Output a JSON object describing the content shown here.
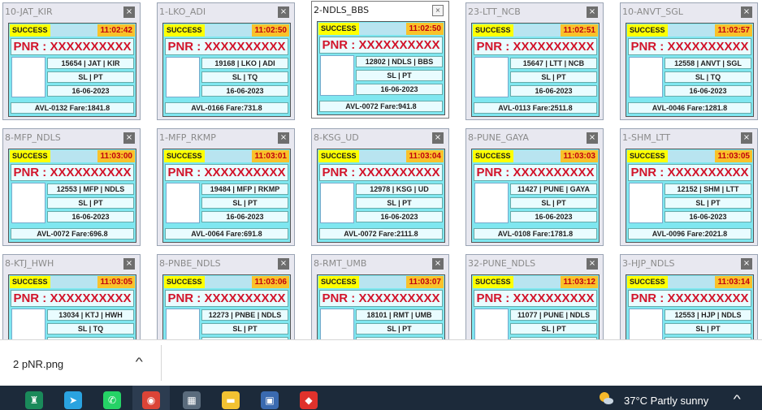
{
  "tiles": [
    {
      "title": "10-JAT_KIR",
      "status": "SUCCESS",
      "time": "11:02:42",
      "pnr": "PNR : XXXXXXXXXX",
      "train": "15654 | JAT | KIR",
      "cls": "SL | PT",
      "date": "16-06-2023",
      "avl": "AVL-0132 Fare:1841.8"
    },
    {
      "title": "1-LKO_ADI",
      "status": "SUCCESS",
      "time": "11:02:50",
      "pnr": "PNR : XXXXXXXXXX",
      "train": "19168 | LKO | ADI",
      "cls": "SL | TQ",
      "date": "16-06-2023",
      "avl": "AVL-0166 Fare:731.8"
    },
    {
      "title": "2-NDLS_BBS",
      "status": "SUCCESS",
      "time": "11:02:50",
      "pnr": "PNR : XXXXXXXXXX",
      "train": "12802 | NDLS | BBS",
      "cls": "SL | PT",
      "date": "16-06-2023",
      "avl": "AVL-0072 Fare:941.8",
      "active": true
    },
    {
      "title": "23-LTT_NCB",
      "status": "SUCCESS",
      "time": "11:02:51",
      "pnr": "PNR : XXXXXXXXXX",
      "train": "15647 | LTT | NCB",
      "cls": "SL | PT",
      "date": "16-06-2023",
      "avl": "AVL-0113 Fare:2511.8"
    },
    {
      "title": "10-ANVT_SGL",
      "status": "SUCCESS",
      "time": "11:02:57",
      "pnr": "PNR : XXXXXXXXXX",
      "train": "12558 | ANVT | SGL",
      "cls": "SL | TQ",
      "date": "16-06-2023",
      "avl": "AVL-0046 Fare:1281.8"
    },
    {
      "title": "8-MFP_NDLS",
      "status": "SUCCESS",
      "time": "11:03:00",
      "pnr": "PNR : XXXXXXXXXX",
      "train": "12553 | MFP | NDLS",
      "cls": "SL | PT",
      "date": "16-06-2023",
      "avl": "AVL-0072 Fare:696.8"
    },
    {
      "title": "1-MFP_RKMP",
      "status": "SUCCESS",
      "time": "11:03:01",
      "pnr": "PNR : XXXXXXXXXX",
      "train": "19484 | MFP | RKMP",
      "cls": "SL | PT",
      "date": "16-06-2023",
      "avl": "AVL-0064 Fare:691.8"
    },
    {
      "title": "8-KSG_UD",
      "status": "SUCCESS",
      "time": "11:03:04",
      "pnr": "PNR : XXXXXXXXXX",
      "train": "12978 | KSG | UD",
      "cls": "SL | PT",
      "date": "16-06-2023",
      "avl": "AVL-0072 Fare:2111.8"
    },
    {
      "title": "8-PUNE_GAYA",
      "status": "SUCCESS",
      "time": "11:03:03",
      "pnr": "PNR : XXXXXXXXXX",
      "train": "11427 | PUNE | GAYA",
      "cls": "SL | PT",
      "date": "16-06-2023",
      "avl": "AVL-0108 Fare:1781.8"
    },
    {
      "title": "1-SHM_LTT",
      "status": "SUCCESS",
      "time": "11:03:05",
      "pnr": "PNR : XXXXXXXXXX",
      "train": "12152 | SHM | LTT",
      "cls": "SL | PT",
      "date": "16-06-2023",
      "avl": "AVL-0096 Fare:2021.8"
    },
    {
      "title": "8-KTJ_HWH",
      "status": "SUCCESS",
      "time": "11:03:05",
      "pnr": "PNR : XXXXXXXXXX",
      "train": "13034 | KTJ | HWH",
      "cls": "SL | TQ",
      "date": "",
      "avl": ""
    },
    {
      "title": "8-PNBE_NDLS",
      "status": "SUCCESS",
      "time": "11:03:06",
      "pnr": "PNR : XXXXXXXXXX",
      "train": "12273 | PNBE | NDLS",
      "cls": "SL | PT",
      "date": "",
      "avl": ""
    },
    {
      "title": "8-RMT_UMB",
      "status": "SUCCESS",
      "time": "11:03:07",
      "pnr": "PNR : XXXXXXXXXX",
      "train": "18101 | RMT | UMB",
      "cls": "SL | PT",
      "date": "",
      "avl": ""
    },
    {
      "title": "32-PUNE_NDLS",
      "status": "SUCCESS",
      "time": "11:03:12",
      "pnr": "PNR : XXXXXXXXXX",
      "train": "11077 | PUNE | NDLS",
      "cls": "SL | PT",
      "date": "",
      "avl": ""
    },
    {
      "title": "3-HJP_NDLS",
      "status": "SUCCESS",
      "time": "11:03:14",
      "pnr": "PNR : XXXXXXXXXX",
      "train": "12553 | HJP | NDLS",
      "cls": "SL | PT",
      "date": "",
      "avl": ""
    }
  ],
  "tile_close_glyph": "×",
  "download_bar": {
    "filename": "2 pNR.png",
    "chevron": "^"
  },
  "taskbar": {
    "icons": [
      {
        "name": "app-shield-icon",
        "color": "#1a8a5a",
        "glyph": "♜"
      },
      {
        "name": "telegram-icon",
        "color": "#2aa3e0",
        "glyph": "➤"
      },
      {
        "name": "whatsapp-icon",
        "color": "#25d366",
        "glyph": "✆"
      },
      {
        "name": "chrome-icon",
        "color": "#db4437",
        "glyph": "◉"
      },
      {
        "name": "calculator-icon",
        "color": "#5a6b7c",
        "glyph": "▦"
      },
      {
        "name": "file-explorer-icon",
        "color": "#f2c232",
        "glyph": "▬"
      },
      {
        "name": "network-app-icon",
        "color": "#3a6ab0",
        "glyph": "▣"
      },
      {
        "name": "anydesk-icon",
        "color": "#e0322c",
        "glyph": "◆"
      }
    ],
    "weather": "37°C  Partly sunny",
    "tray_chevron": "^"
  }
}
